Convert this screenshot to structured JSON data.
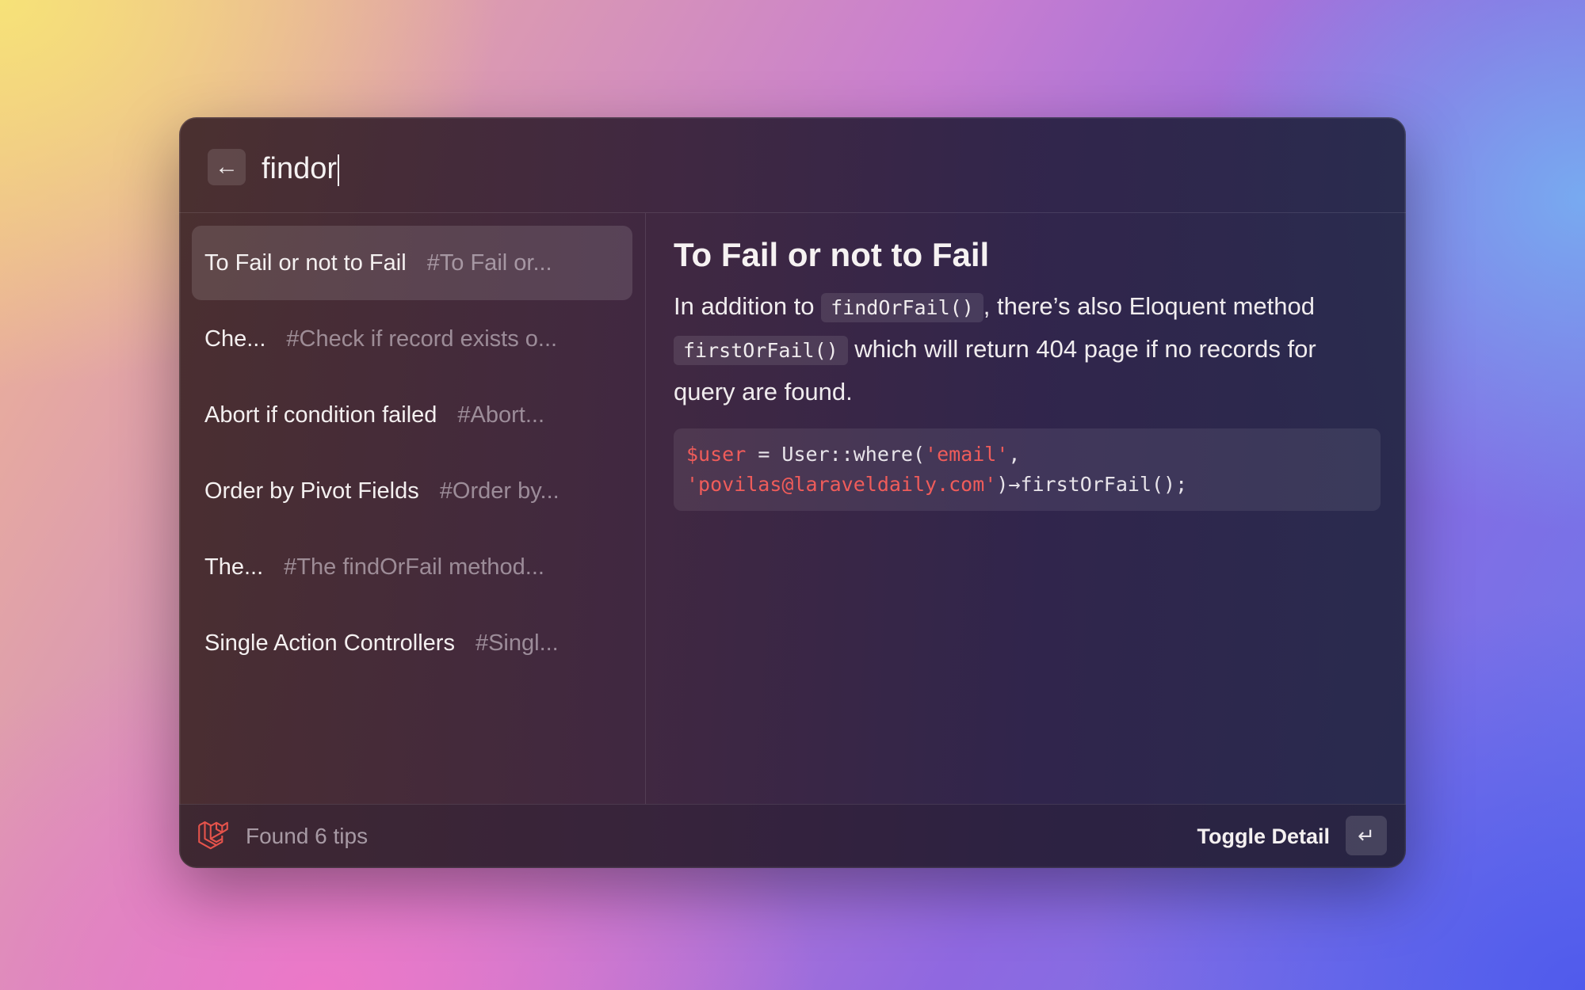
{
  "search": {
    "value": "findor",
    "back_icon": "arrow-left-icon"
  },
  "results": [
    {
      "title": "To Fail or not to Fail",
      "subtitle": "#To Fail or...",
      "selected": true
    },
    {
      "title": "Che...",
      "subtitle": "#Check if record exists o...",
      "selected": false
    },
    {
      "title": "Abort if condition failed",
      "subtitle": "#Abort...",
      "selected": false
    },
    {
      "title": "Order by Pivot Fields",
      "subtitle": "#Order by...",
      "selected": false
    },
    {
      "title": "The...",
      "subtitle": "#The findOrFail method...",
      "selected": false
    },
    {
      "title": "Single Action Controllers",
      "subtitle": "#Singl...",
      "selected": false
    }
  ],
  "detail": {
    "title": "To Fail or not to Fail",
    "text_1": "In addition to ",
    "code_1": "findOrFail()",
    "text_2": ", there’s also Eloquent method ",
    "code_2": "firstOrFail()",
    "text_3": " which will return 404 page if no records for query are found.",
    "code_block": {
      "var": "$user",
      "part_1": " = User::where(",
      "str_1": "'email'",
      "part_2": ",",
      "str_2": "'povilas@laraveldaily.com'",
      "part_3": ")→firstOrFail();"
    }
  },
  "footer": {
    "status": "Found 6 tips",
    "action_label": "Toggle Detail",
    "enter_icon": "return-key-icon",
    "logo_icon": "laravel-logo-icon"
  },
  "colors": {
    "accent_red": "#ef5c5a"
  }
}
